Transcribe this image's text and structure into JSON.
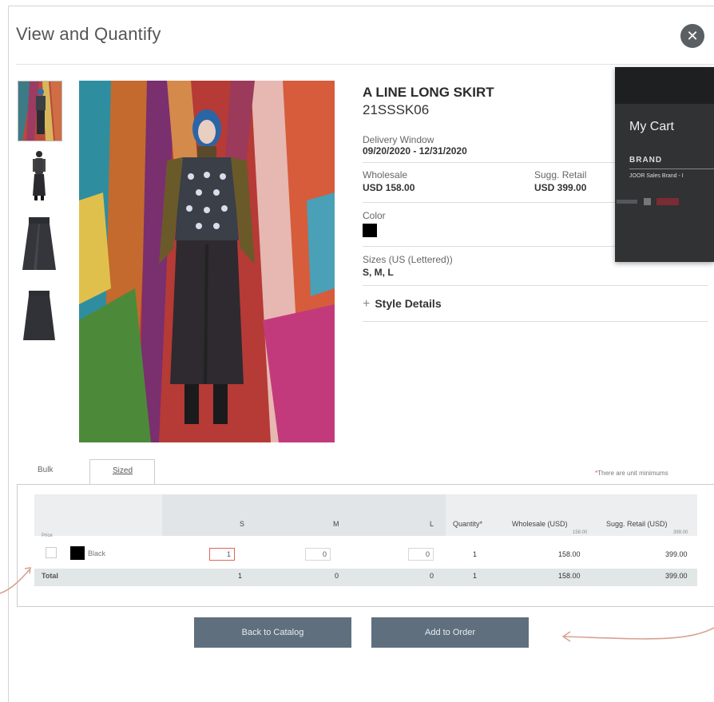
{
  "modal": {
    "title": "View and Quantify",
    "close_icon": "close-icon"
  },
  "thumbnails": [
    "runway-look-thumbnail",
    "model-front-thumbnail",
    "skirt-front-thumbnail",
    "skirt-back-thumbnail"
  ],
  "product": {
    "name": "A LINE LONG SKIRT",
    "sku": "21SSSK06",
    "delivery_label": "Delivery Window",
    "delivery_value": "09/20/2020 - 12/31/2020",
    "wholesale_label": "Wholesale",
    "wholesale_value": "USD 158.00",
    "retail_label": "Sugg. Retail",
    "retail_value": "USD 399.00",
    "color_label": "Color",
    "color_swatch": "#000000",
    "sizes_label": "Sizes (US (Lettered))",
    "sizes_value": "S, M, L",
    "style_details": "Style Details"
  },
  "cart": {
    "title": "My Cart",
    "brand_label": "BRAND",
    "item": "JOOR Sales Brand - I"
  },
  "tabs": {
    "bulk": "Bulk",
    "sized": "Sized"
  },
  "minimums_note": "There are unit minimums",
  "table": {
    "columns": [
      "S",
      "M",
      "L",
      "Quantity*",
      "Wholesale (USD)",
      "Sugg. Retail (USD)"
    ],
    "price_label": "Price",
    "price_wholesale": "158.00",
    "price_retail": "399.00",
    "row": {
      "color": "Black",
      "swatch": "#000000",
      "qty_s": "1",
      "qty_m": "0",
      "qty_l": "0",
      "quantity": "1",
      "wholesale": "158.00",
      "retail": "399.00"
    },
    "total": {
      "label": "Total",
      "s": "1",
      "m": "0",
      "l": "0",
      "quantity": "1",
      "wholesale": "158.00",
      "retail": "399.00"
    }
  },
  "buttons": {
    "back": "Back to Catalog",
    "add": "Add to Order"
  },
  "colors": {
    "button": "#5f6f7e",
    "accent_red": "#e0645a",
    "arrow": "#d7a28f",
    "close": "#5a5f64"
  }
}
